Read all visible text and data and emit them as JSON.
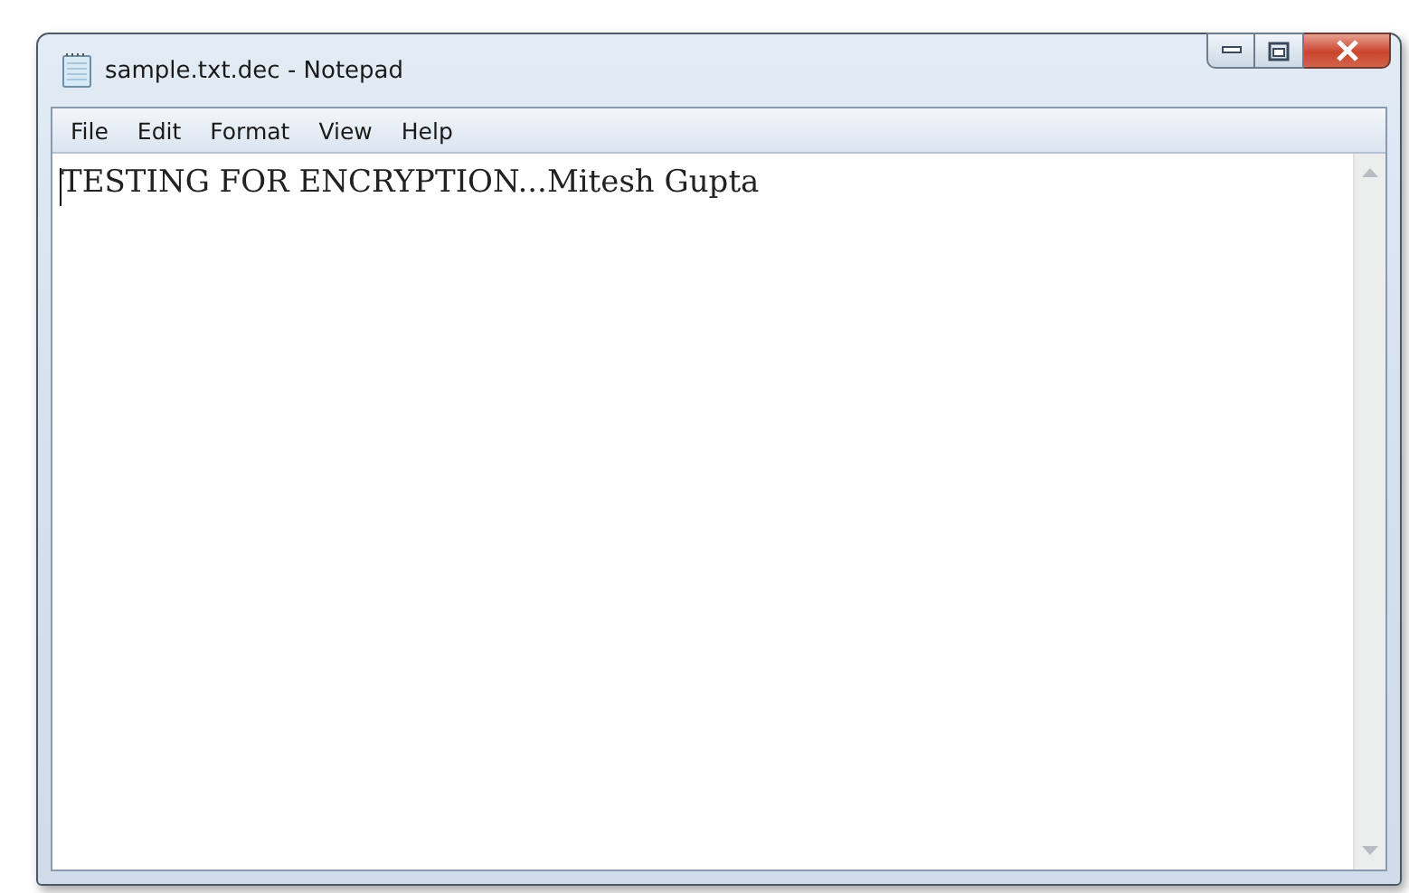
{
  "window": {
    "title": "sample.txt.dec - Notepad"
  },
  "menu": [
    "File",
    "Edit",
    "Format",
    "View",
    "Help"
  ],
  "document": {
    "text": "TESTING FOR ENCRYPTION...Mitesh Gupta"
  }
}
